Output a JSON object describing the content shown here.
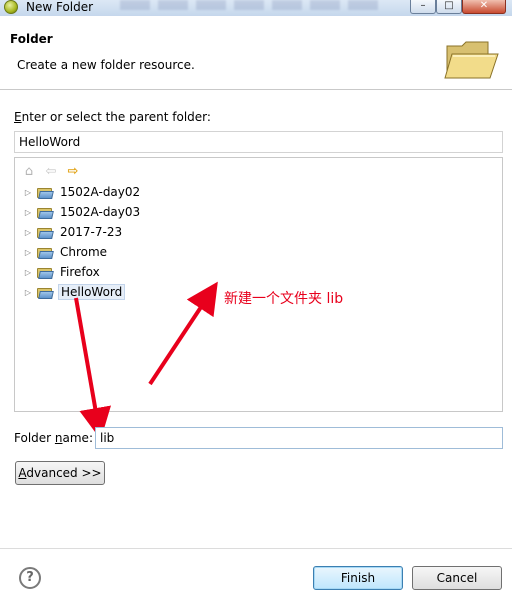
{
  "window": {
    "title": "New Folder"
  },
  "banner": {
    "title": "Folder",
    "description": "Create a new folder resource."
  },
  "parent": {
    "label_accel": "E",
    "label_rest": "nter or select the parent folder:",
    "value": "HelloWord"
  },
  "tree": {
    "items": [
      {
        "label": "1502A-day02"
      },
      {
        "label": "1502A-day03"
      },
      {
        "label": "2017-7-23"
      },
      {
        "label": "Chrome"
      },
      {
        "label": "Firefox"
      },
      {
        "label": "HelloWord"
      }
    ],
    "selected": "HelloWord"
  },
  "folder_name": {
    "label_pre": "Folder ",
    "label_accel": "n",
    "label_post": "ame:",
    "value": "lib"
  },
  "buttons": {
    "advanced_accel": "A",
    "advanced_rest": "dvanced >>",
    "finish": "Finish",
    "cancel": "Cancel",
    "help": "?"
  },
  "annotation": {
    "text": "新建一个文件夹 lib",
    "color": "#e8001c"
  },
  "icons": {
    "title": "eclipse-icon",
    "banner": "folder-large-icon",
    "home": "home-icon",
    "back": "back-arrow-icon",
    "forward": "forward-arrow-icon",
    "item": "folder-icon",
    "expand": "expand-triangle-icon"
  }
}
